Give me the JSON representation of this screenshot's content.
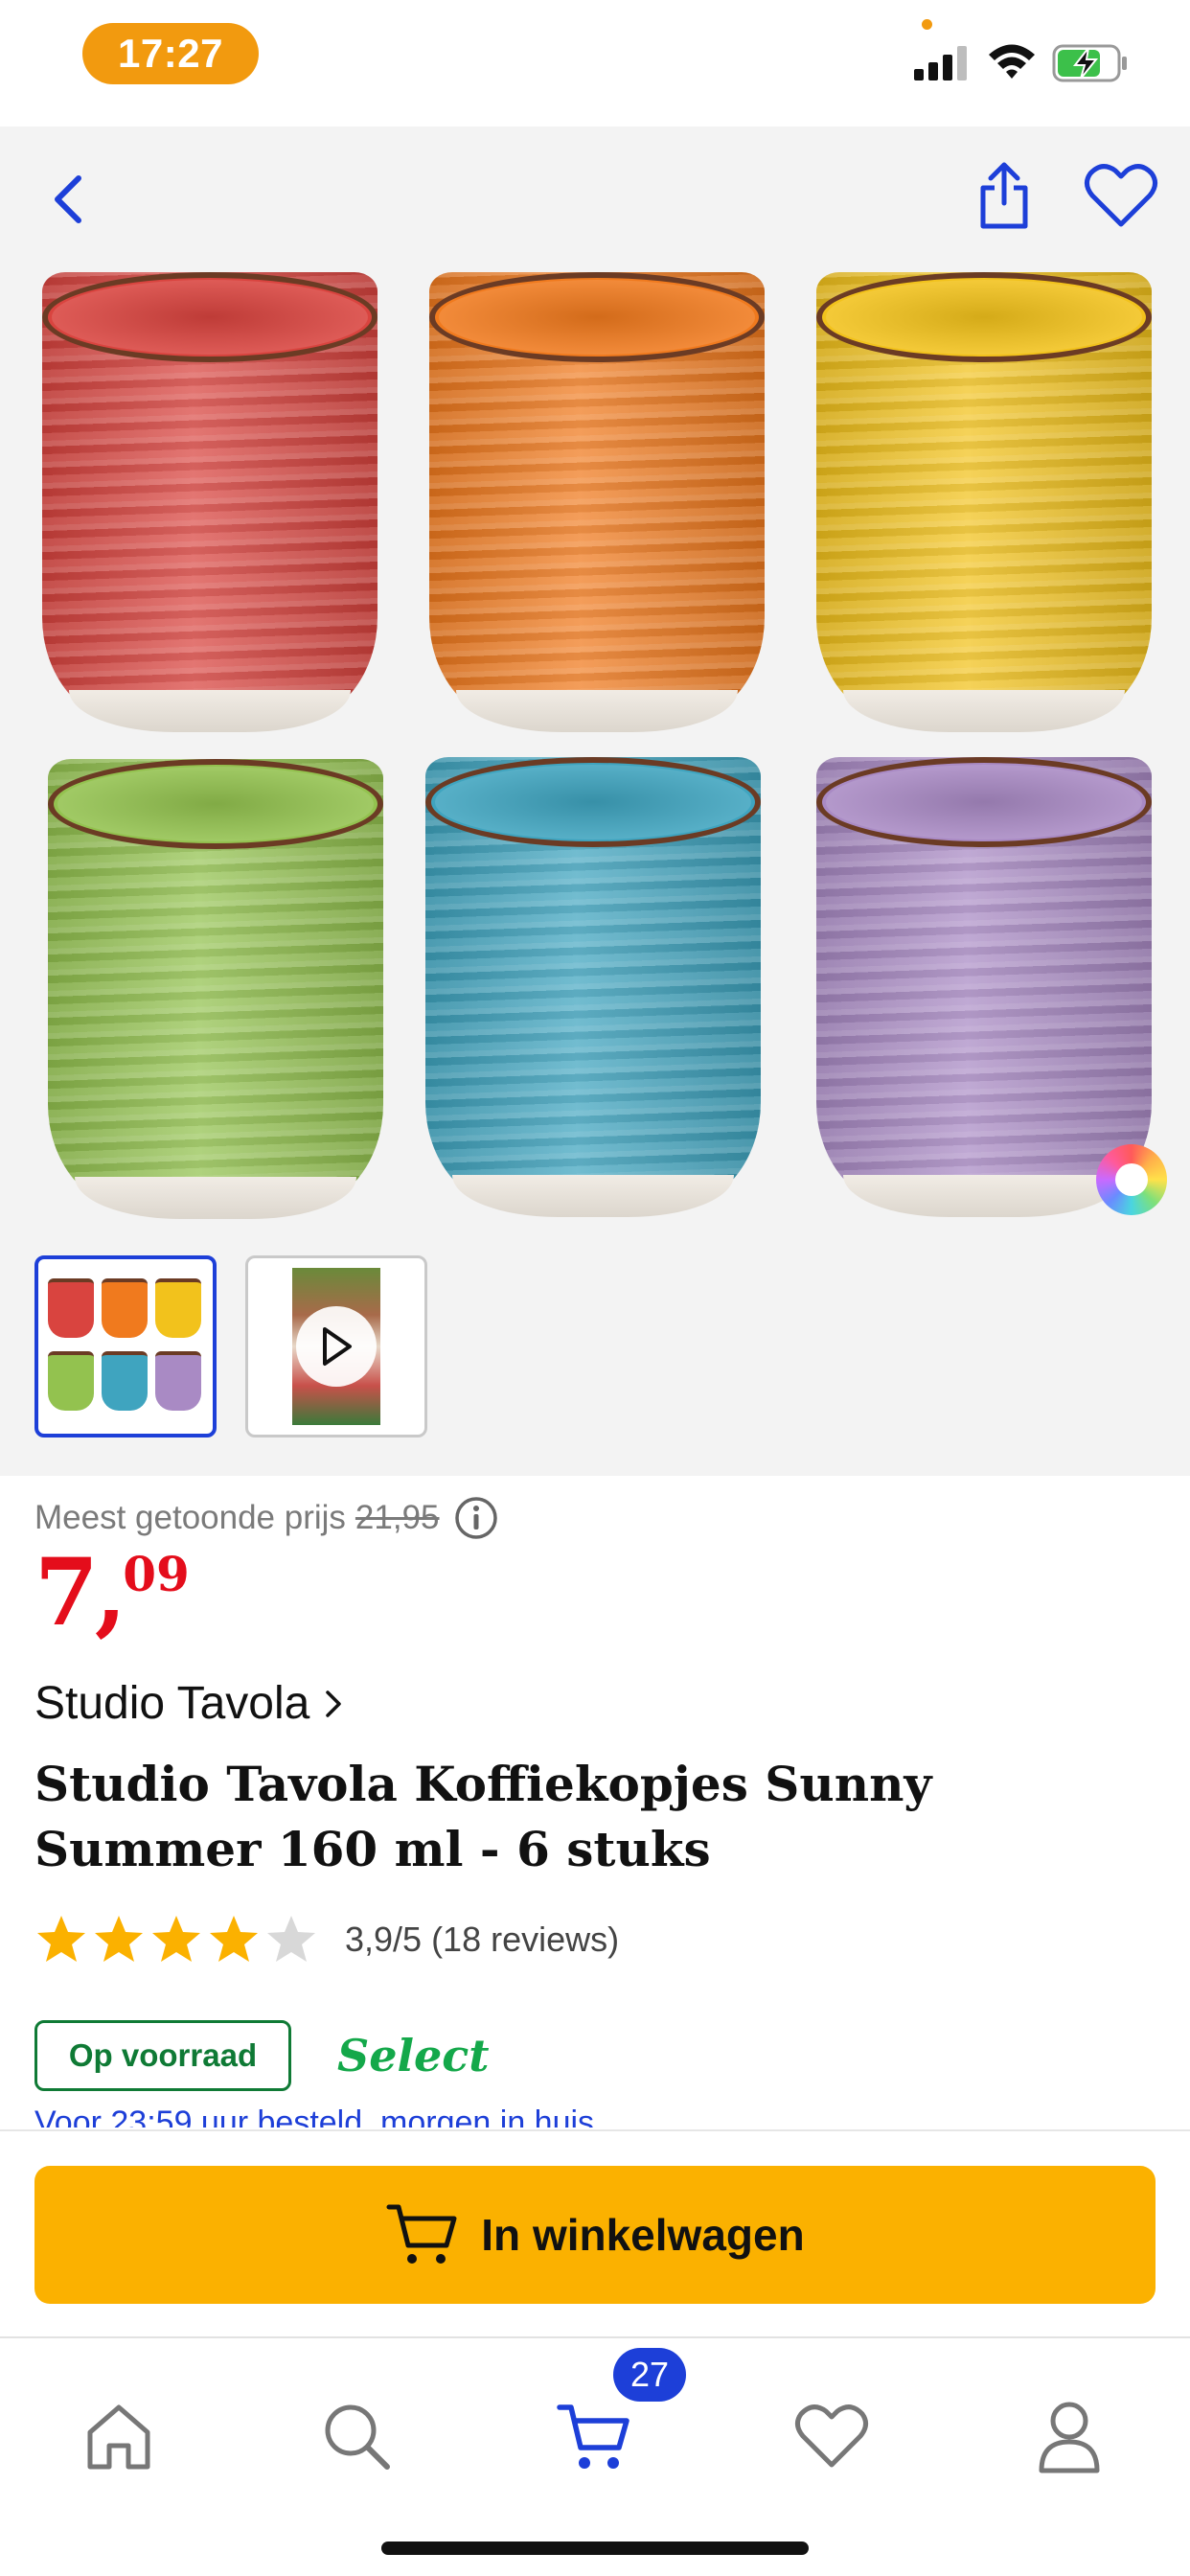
{
  "status_bar": {
    "time": "17:27",
    "icons": [
      "signal-icon",
      "wifi-icon",
      "battery-charging-icon"
    ],
    "accent_color": "#F29A0F"
  },
  "gallery": {
    "icons": [
      "back-chevron-icon",
      "share-icon",
      "heart-icon"
    ],
    "cup_colors": [
      "#D9443F",
      "#F07A1E",
      "#F2C21C",
      "#93C24F",
      "#3FA4BF",
      "#A98AC4"
    ],
    "thumbnails": [
      {
        "kind": "image",
        "selected": true
      },
      {
        "kind": "video",
        "selected": false
      }
    ],
    "color_picker_icon": "color-wheel-icon"
  },
  "product": {
    "reference_price_label": "Meest getoonde prijs",
    "reference_price_value": "21,95",
    "price_integer": "7,",
    "price_decimals": "09",
    "price_color": "#E40D1B",
    "brand": "Studio Tavola",
    "title": "Studio Tavola Koffiekopjes Sunny Summer 160 ml - 6 stuks",
    "rating": 3.9,
    "rating_text": "3,9/5 (18 reviews)",
    "stock_label": "Op voorraad",
    "select_label": "Select",
    "cutoff_line": "Voor 23:59 uur besteld, morgen in huis"
  },
  "cart": {
    "button_label": "In winkelwagen",
    "button_color": "#FBB100"
  },
  "nav": {
    "items": [
      "home-icon",
      "search-icon",
      "cart-icon",
      "heart-icon",
      "account-icon"
    ],
    "active": "cart-icon",
    "cart_count": "27",
    "active_color": "#1D3FD8"
  }
}
